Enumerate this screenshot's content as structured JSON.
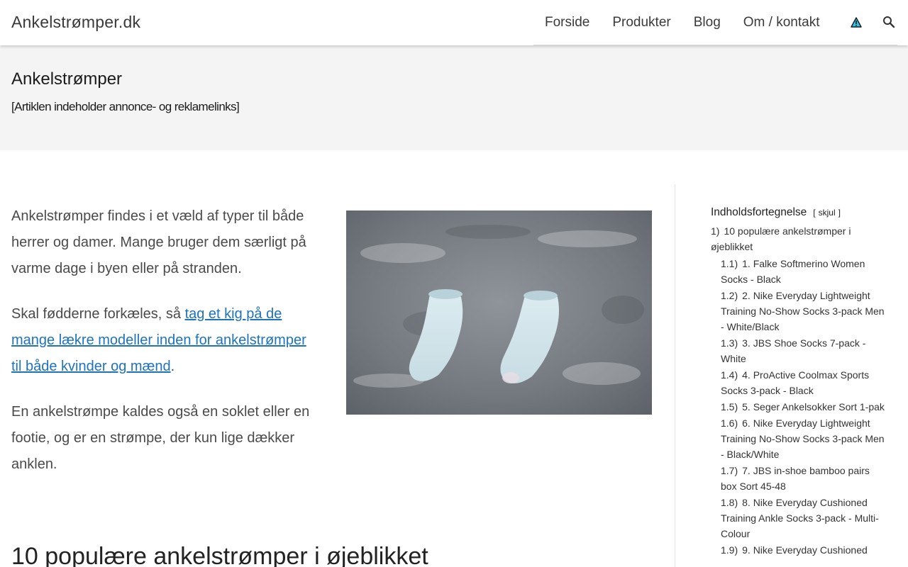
{
  "site": {
    "title": "Ankelstrømper.dk"
  },
  "nav": {
    "items": [
      "Forside",
      "Produkter",
      "Blog",
      "Om / kontakt"
    ],
    "icons": [
      "warning-icon",
      "search-icon"
    ]
  },
  "page": {
    "title": "Ankelstrømper",
    "subtitle": "[Artiklen indeholder annonce- og reklamelinks]"
  },
  "content": {
    "para1": "Ankelstrømper findes i et væld af typer til både herrer og damer. Mange bruger dem særligt på varme dage i byen eller på stranden.",
    "para2_before": "Skal fødderne forkæles, så ",
    "para2_link": "tag et kig på de mange lækre modeller inden for ankelstrømper til både kvinder og mænd",
    "para2_after": ".",
    "para3": "En ankelstrømpe kaldes også en soklet eller en footie, og er en strømpe, der kun lige dækker anklen.",
    "section_heading": "10 populære ankelstrømper i øjeblikket"
  },
  "toc": {
    "title": "Indholdsfortegnelse",
    "toggle_open": "[",
    "toggle_label": "skjul",
    "toggle_close": "]",
    "items": [
      {
        "num": "1)",
        "text": "10 populære ankelstrømper i øjeblikket",
        "level": 1
      },
      {
        "num": "1.1)",
        "text": "1. Falke Softmerino Women Socks - Black",
        "level": 2
      },
      {
        "num": "1.2)",
        "text": "2. Nike Everyday Lightweight Training No-Show Socks 3-pack Men - White/Black",
        "level": 2
      },
      {
        "num": "1.3)",
        "text": "3. JBS Shoe Socks 7-pack - White",
        "level": 2
      },
      {
        "num": "1.4)",
        "text": "4. ProActive Coolmax Sports Socks 3-pack - Black",
        "level": 2
      },
      {
        "num": "1.5)",
        "text": "5. Seger Ankelsokker Sort 1-pak",
        "level": 2
      },
      {
        "num": "1.6)",
        "text": "6. Nike Everyday Lightweight Training No-Show Socks 3-pack Men - Black/White",
        "level": 2
      },
      {
        "num": "1.7)",
        "text": "7. JBS in-shoe bamboo pairs box Sort 45-48",
        "level": 2
      },
      {
        "num": "1.8)",
        "text": "8. Nike Everyday Cushioned Training Ankle Socks 3-pack - Multi-Colour",
        "level": 2
      },
      {
        "num": "1.9)",
        "text": "9. Nike Everyday Cushioned",
        "level": 2
      }
    ]
  },
  "colors": {
    "link": "#1e73be",
    "title_band": "#f4f4f4",
    "warning_fill": "#2ec4e6"
  }
}
